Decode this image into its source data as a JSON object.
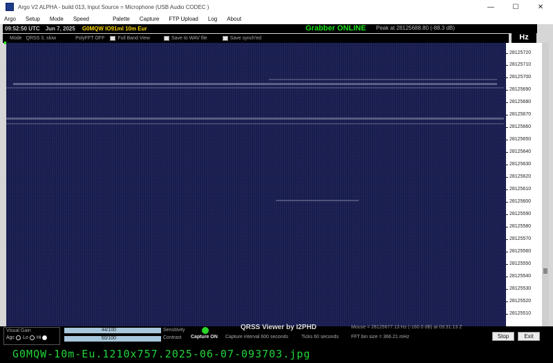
{
  "window": {
    "title": "Argo V2 ALPHA - build 013, Input Source = Microphone (USB Audio CODEC )",
    "controls": {
      "minimize": "—",
      "maximize": "☐",
      "close": "✕"
    }
  },
  "menu": [
    "Argo",
    "Setup",
    "Mode",
    "Speed",
    "Palette",
    "Capture",
    "FTP Upload",
    "Log",
    "About"
  ],
  "status": {
    "time": "09:52:50 UTC",
    "date": "Jun 7, 2025",
    "callsign": "G0MQW IO91ml 10m Eur",
    "grabber": "Grabber ONLINE",
    "peak": "Peak at 28125688.80 (-88.3 dB)"
  },
  "options": {
    "mode_label": "Mode",
    "mode_value": "QRSS 3, slow",
    "polyfft": "PolyFFT OFF",
    "full_band": "Full Band View",
    "save_wav": "Save to WAV file",
    "save_synched": "Save synch'ed"
  },
  "scale": {
    "unit": "Hz",
    "labels": [
      "28125720",
      "28125710",
      "28125700",
      "28125690",
      "28125680",
      "28125670",
      "28125660",
      "28125650",
      "28125640",
      "28125630",
      "28125620",
      "28125610",
      "28125600",
      "28125590",
      "28125580",
      "28125570",
      "28125560",
      "28125550",
      "28125540",
      "28125530",
      "28125520",
      "28125510"
    ]
  },
  "bottom": {
    "visual_gain": "Visual Gain",
    "agc": "Agc",
    "lo": "Lo",
    "hi": "Hi",
    "gain_value": "44/100",
    "contrast_value": "50/100",
    "sensitivity": "Sensitivity",
    "contrast": "Contrast",
    "capture_on": "Capture ON",
    "viewer": "QRSS Viewer by I2PHD",
    "capture_interval": "Capture interval 600 seconds",
    "ticks": "Ticks 60 seconds",
    "mouse": "Mouse = 28125677.13 Hz (-160.0 dB) at 09:31:13 Z",
    "fft_bin": "FFT bin size = 366.21 mHz",
    "stop": "Stop",
    "exit": "Exit",
    "gain_level": 0.44,
    "contrast_level": 0.5
  },
  "filename": "G0MQW-10m-Eu.1210x757.2025-06-07-093703.jpg",
  "colors": {
    "waterfall": "#1a1f56",
    "grabber": "#17e217",
    "callsign": "#ffd800",
    "filename": "#21d63b"
  }
}
